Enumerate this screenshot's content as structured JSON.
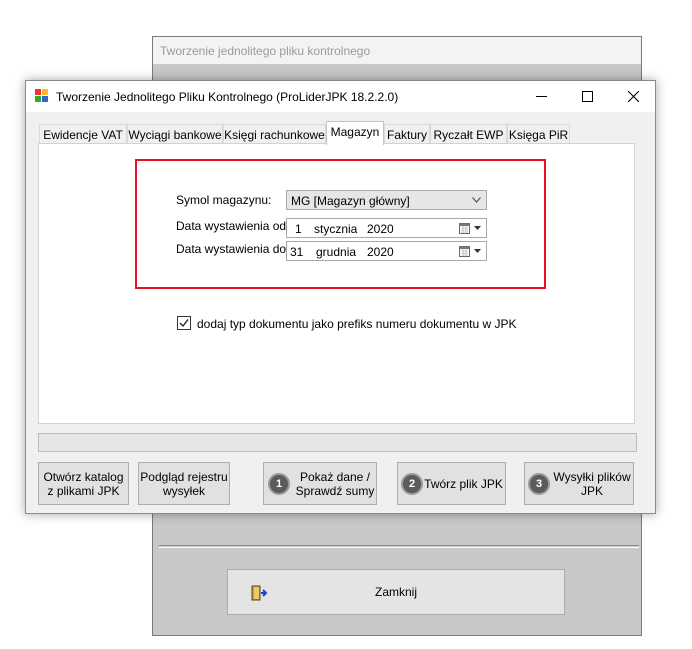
{
  "background_window": {
    "title": "Tworzenie jednolitego pliku kontrolnego",
    "close_label": "Zamknij"
  },
  "window": {
    "title": "Tworzenie Jednolitego Pliku Kontrolnego (ProLiderJPK 18.2.2.0)"
  },
  "tabs": [
    {
      "label": "Ewidencje  VAT"
    },
    {
      "label": "Wyciągi bankowe"
    },
    {
      "label": "Księgi rachunkowe"
    },
    {
      "label": "Magazyn",
      "active": true
    },
    {
      "label": "Faktury"
    },
    {
      "label": "Ryczałt EWP"
    },
    {
      "label": "Księga PiR"
    }
  ],
  "form": {
    "warehouse_label": "Symol magazynu:",
    "warehouse_value": "MG [Magazyn główny]",
    "date_from_label": "Data wystawienia od:",
    "date_from": {
      "day": "1",
      "month": "stycznia",
      "year": "2020"
    },
    "date_to_label": "Data wystawienia do:",
    "date_to": {
      "day": "31",
      "month": "grudnia",
      "year": "2020"
    },
    "checkbox_label": "dodaj typ dokumentu jako prefiks numeru dokumentu w JPK",
    "checkbox_checked": true
  },
  "buttons": {
    "open_folder_line1": "Otwórz katalog",
    "open_folder_line2": "z plikami JPK",
    "preview_line1": "Podgląd rejestru",
    "preview_line2": "wysyłek",
    "step1_num": "1",
    "step1_line1": "Pokaż dane /",
    "step1_line2": "Sprawdź sumy",
    "step2_num": "2",
    "step2_label": "Twórz plik JPK",
    "step3_num": "3",
    "step3_line1": "Wysyłki plików",
    "step3_line2": "JPK"
  },
  "colors": {
    "highlight_border": "#e81123"
  }
}
